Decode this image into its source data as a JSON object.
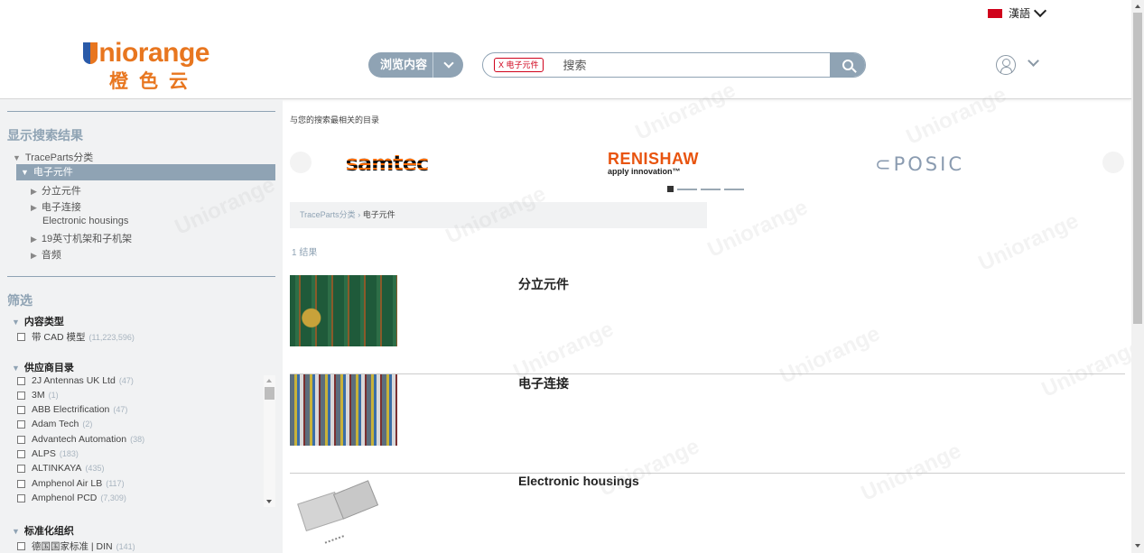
{
  "header": {
    "language": "漢語",
    "logo_word": "niorange",
    "logo_cn": "橙色云",
    "browse_label": "浏览内容",
    "search_chip": "X 电子元件",
    "search_placeholder": "搜索"
  },
  "sidebar": {
    "results_heading": "显示搜索结果",
    "tree": {
      "root": "TraceParts分类",
      "selected": "电子元件",
      "children": [
        "分立元件",
        "电子连接",
        "Electronic housings",
        "19英寸机架和子机架",
        "音频"
      ]
    },
    "filter_heading": "筛选",
    "content_type": {
      "heading": "内容类型",
      "items": [
        {
          "label": "带 CAD 模型",
          "count": "(11,223,596)"
        }
      ]
    },
    "supplier_catalog": {
      "heading": "供应商目录",
      "items": [
        {
          "label": "2J Antennas UK Ltd",
          "count": "(47)"
        },
        {
          "label": "3M",
          "count": "(1)"
        },
        {
          "label": "ABB Electrification",
          "count": "(47)"
        },
        {
          "label": "Adam Tech",
          "count": "(2)"
        },
        {
          "label": "Advantech Automation",
          "count": "(38)"
        },
        {
          "label": "ALPS",
          "count": "(183)"
        },
        {
          "label": "ALTINKAYA",
          "count": "(435)"
        },
        {
          "label": "Amphenol Air LB",
          "count": "(117)"
        },
        {
          "label": "Amphenol PCD",
          "count": "(7,309)"
        }
      ]
    },
    "standards_org": {
      "heading": "标准化组织",
      "items": [
        {
          "label": "德国国家标准 | DIN",
          "count": "(141)"
        }
      ]
    }
  },
  "main": {
    "subtitle": "与您的搜索最相关的目录",
    "brands": {
      "samtec": "samtec",
      "renishaw": "RENISHAW",
      "renishaw_tag": "apply innovation™",
      "posic": "POSIC"
    },
    "breadcrumb": {
      "root": "TraceParts分类",
      "sep": "›",
      "current": "电子元件"
    },
    "results_count": "1 结果",
    "cards": [
      {
        "title": "分立元件"
      },
      {
        "title": "电子连接"
      },
      {
        "title": "Electronic housings"
      }
    ]
  },
  "watermark": "Uniorange",
  "colors": {
    "accent": "#8fa3b4",
    "brand": "#e8761f",
    "chip": "#d0021b"
  }
}
